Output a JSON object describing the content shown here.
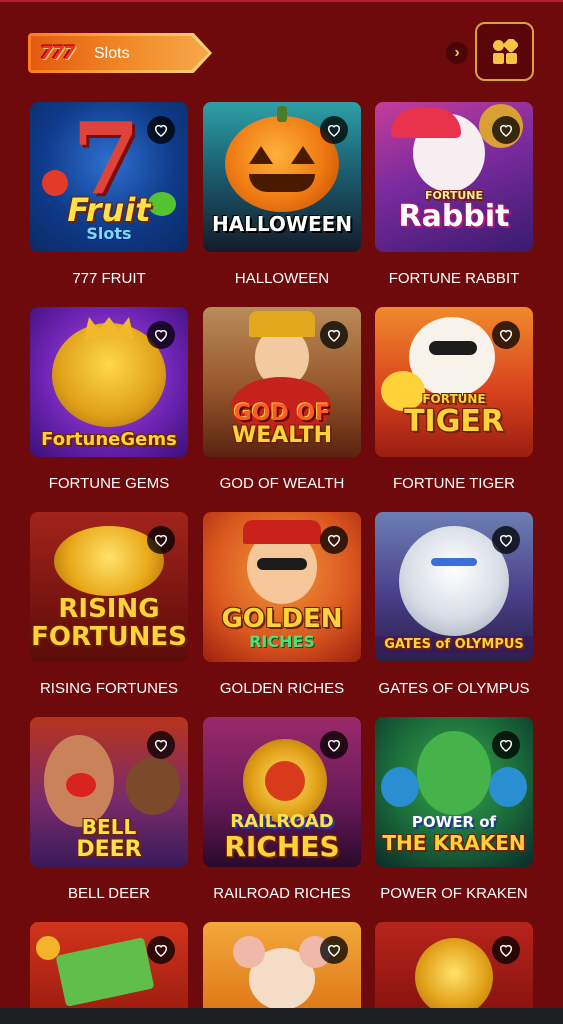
{
  "header": {
    "section_logo_text": "777",
    "section_label": "Slots",
    "next_arrow": "›",
    "grid_icon": "category-grid-icon"
  },
  "colors": {
    "background": "#6e0a0c",
    "accent_gold": "#d8a33a",
    "banner_orange": "#f28e2b"
  },
  "games": [
    {
      "title": "777 FRUIT",
      "art_line1": "Fruit",
      "art_line2": "Slots"
    },
    {
      "title": "HALLOWEEN",
      "art_line1": "HALLOWEEN",
      "art_line2": ""
    },
    {
      "title": "FORTUNE RABBIT",
      "art_line1": "FORTUNE",
      "art_line2": "Rabbit"
    },
    {
      "title": "FORTUNE GEMS",
      "art_line1": "FortuneGems",
      "art_line2": ""
    },
    {
      "title": "GOD OF WEALTH",
      "art_line1": "GOD OF",
      "art_line2": "WEALTH"
    },
    {
      "title": "FORTUNE TIGER",
      "art_line1": "FORTUNE",
      "art_line2": "TIGER"
    },
    {
      "title": "RISING FORTUNES",
      "art_line1": "RISING",
      "art_line2": "FORTUNES"
    },
    {
      "title": "GOLDEN RICHES",
      "art_line1": "GOLDEN",
      "art_line2": "RICHES"
    },
    {
      "title": "GATES OF OLYMPUS",
      "art_line1": "GATES of OLYMPUS",
      "art_line2": ""
    },
    {
      "title": "BELL DEER",
      "art_line1": "BELL",
      "art_line2": "DEER"
    },
    {
      "title": "RAILROAD RICHES",
      "art_line1": "RAILROAD",
      "art_line2": "RICHES"
    },
    {
      "title": "POWER OF KRAKEN",
      "art_line1": "POWER of",
      "art_line2": "THE KRAKEN"
    }
  ]
}
